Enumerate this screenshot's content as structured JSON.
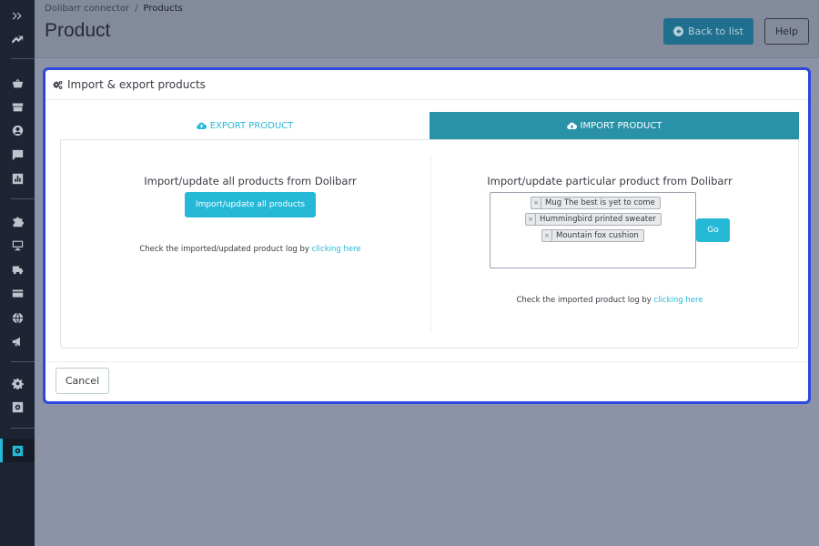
{
  "header": {
    "breadcrumb": [
      "Dolibarr connector",
      "Products"
    ],
    "breadcrumb_sep": "/",
    "title": "Product",
    "back_label": "Back to list",
    "help_label": "Help"
  },
  "sidebar": {
    "icons": [
      "expand-icon",
      "trend-icon",
      "basket-icon",
      "store-icon",
      "user-icon",
      "chat-icon",
      "stats-icon",
      "puzzle-icon",
      "monitor-icon",
      "truck-icon",
      "card-icon",
      "globe-icon",
      "megaphone-icon",
      "settings-icon",
      "module-settings-icon",
      "module-icon"
    ]
  },
  "modal": {
    "title": "Import & export products",
    "tabs": [
      {
        "label": "EXPORT PRODUCT",
        "active": false
      },
      {
        "label": "IMPORT PRODUCT",
        "active": true
      }
    ],
    "left": {
      "title": "Import/update all products from Dolibarr",
      "button_label": "Import/update all products",
      "log_prefix": "Check the imported/updated product log by ",
      "log_link": "clicking here"
    },
    "right": {
      "title": "Import/update particular product from Dolibarr",
      "selected": [
        "Mug The best is yet to come",
        "Hummingbird printed sweater",
        "Mountain fox cushion"
      ],
      "remove_glyph": "×",
      "go_label": "Go",
      "log_prefix": "Check the imported product log by ",
      "log_link": "clicking here"
    },
    "cancel_label": "Cancel"
  },
  "colors": {
    "accent": "#25b9d7",
    "active_tab": "#2a92a8",
    "modal_border": "#2d47e0",
    "sidebar": "#1e2433"
  }
}
